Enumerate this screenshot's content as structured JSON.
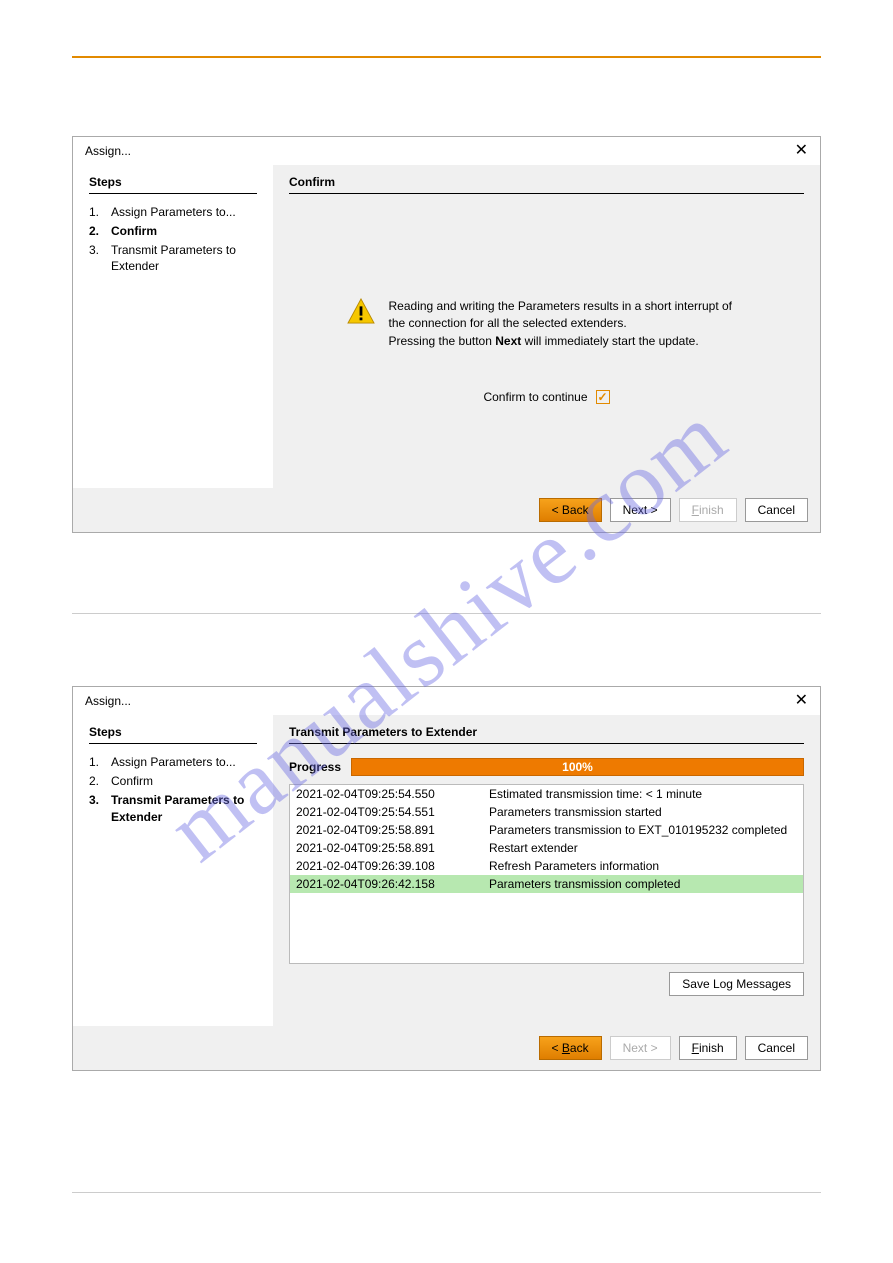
{
  "dialog1": {
    "title": "Assign...",
    "close": "✕",
    "steps_header": "Steps",
    "steps": {
      "s1_num": "1.",
      "s1_label": "Assign Parameters to...",
      "s2_num": "2.",
      "s2_label": "Confirm",
      "s3_num": "3.",
      "s3_label": "Transmit Parameters to Extender"
    },
    "content_header": "Confirm",
    "warn1": "Reading and writing the Parameters results in a short interrupt of the connection for all the selected extenders.",
    "warn2": "Pressing the button ",
    "warn2b": "Next",
    "warn2c": " will immediately start the update.",
    "confirm_label": "Confirm to continue",
    "checkmark": "✓",
    "buttons": {
      "back": "< Back",
      "next": "Next >",
      "finish": "Finish",
      "cancel": "Cancel"
    }
  },
  "dialog2": {
    "title": "Assign...",
    "close": "✕",
    "steps_header": "Steps",
    "steps": {
      "s1_num": "1.",
      "s1_label": "Assign Parameters to...",
      "s2_num": "2.",
      "s2_label": "Confirm",
      "s3_num": "3.",
      "s3_label": "Transmit Parameters to Extender"
    },
    "content_header": "Transmit Parameters to Extender",
    "progress_label": "Progress",
    "progress_value": "100%",
    "log": [
      {
        "ts": "2021-02-04T09:25:54.550",
        "msg": "Estimated transmission time: < 1 minute"
      },
      {
        "ts": "2021-02-04T09:25:54.551",
        "msg": "Parameters transmission started"
      },
      {
        "ts": "2021-02-04T09:25:58.891",
        "msg": "Parameters transmission to EXT_010195232 completed"
      },
      {
        "ts": "2021-02-04T09:25:58.891",
        "msg": "Restart extender"
      },
      {
        "ts": "2021-02-04T09:26:39.108",
        "msg": "Refresh Parameters information"
      },
      {
        "ts": "2021-02-04T09:26:42.158",
        "msg": "Parameters transmission completed"
      }
    ],
    "save_log": "Save Log Messages",
    "buttons": {
      "back": "< Back",
      "next": "Next >",
      "finish": "Finish",
      "cancel": "Cancel"
    }
  },
  "watermark": "manualshive.com"
}
